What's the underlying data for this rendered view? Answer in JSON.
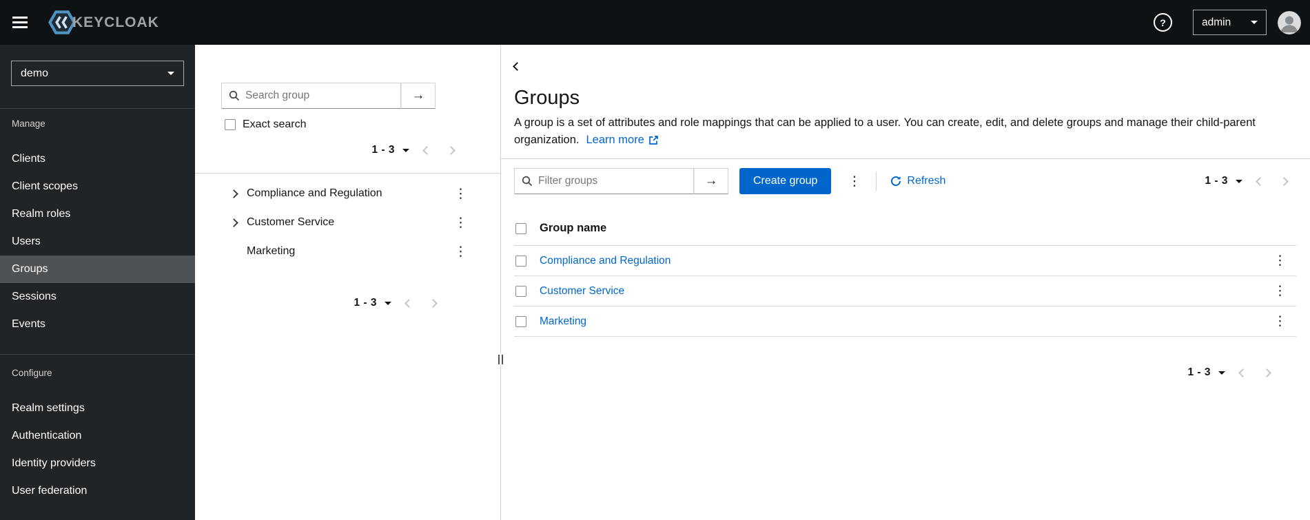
{
  "header": {
    "brand_text": "KEYCLOAK",
    "username": "admin"
  },
  "icons": {
    "help": "?",
    "kebab": "⋮",
    "submit_arrow": "→"
  },
  "sidebar": {
    "realm": "demo",
    "manage_title": "Manage",
    "manage_items": [
      "Clients",
      "Client scopes",
      "Realm roles",
      "Users",
      "Groups",
      "Sessions",
      "Events"
    ],
    "selected_item": "Groups",
    "configure_title": "Configure",
    "configure_items": [
      "Realm settings",
      "Authentication",
      "Identity providers",
      "User federation"
    ]
  },
  "tree_panel": {
    "search_placeholder": "Search group",
    "exact_search_label": "Exact search",
    "pagination_range": "1 - 3",
    "items": [
      {
        "label": "Compliance and Regulation",
        "expandable": true
      },
      {
        "label": "Customer Service",
        "expandable": true
      },
      {
        "label": "Marketing",
        "expandable": false
      }
    ]
  },
  "main": {
    "title": "Groups",
    "description": "A group is a set of attributes and role mappings that can be applied to a user. You can create, edit, and delete groups and manage their child-parent organization.",
    "learn_more_label": "Learn more",
    "toolbar": {
      "filter_placeholder": "Filter groups",
      "create_button_label": "Create group",
      "refresh_label": "Refresh",
      "pagination_range": "1 - 3"
    },
    "table": {
      "name_header": "Group name",
      "rows": [
        {
          "name": "Compliance and Regulation"
        },
        {
          "name": "Customer Service"
        },
        {
          "name": "Marketing"
        }
      ]
    },
    "bottom_pagination_range": "1 - 3"
  },
  "colors": {
    "primary": "#0066cc",
    "link": "#0066cc",
    "header_bg": "#0f1214",
    "sidebar_bg": "#212427",
    "nav_selected_bg": "#4f5255",
    "border": "#d2d2d2"
  }
}
